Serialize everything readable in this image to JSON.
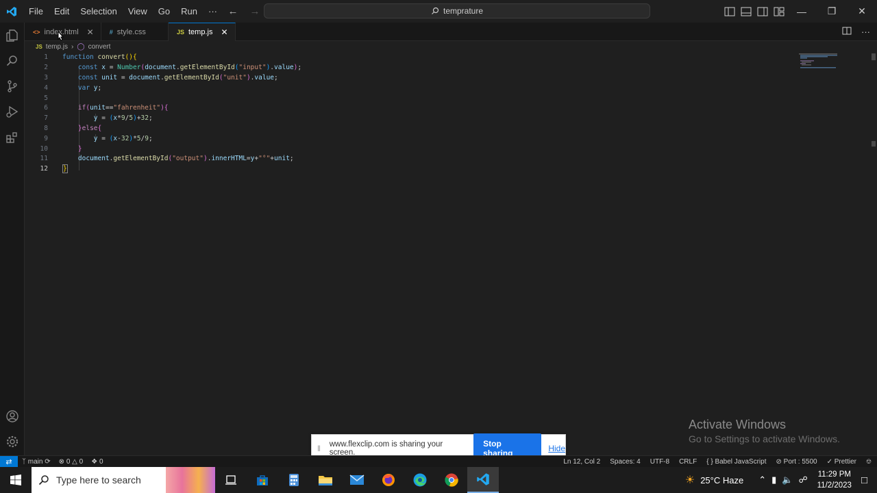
{
  "titlebar": {
    "menu": [
      "File",
      "Edit",
      "Selection",
      "View",
      "Go",
      "Run",
      "···"
    ],
    "search_text": "temprature"
  },
  "tabs": [
    {
      "icon": "<>",
      "label": "index.html",
      "icon_color": "#e37933",
      "active": false
    },
    {
      "icon": "#",
      "label": "style.css",
      "icon_color": "#519aba",
      "active": false
    },
    {
      "icon": "JS",
      "label": "temp.js",
      "icon_color": "#cbcb41",
      "active": true
    }
  ],
  "breadcrumb": {
    "file_icon": "JS",
    "file": "temp.js",
    "symbol": "convert"
  },
  "editor": {
    "line_numbers": [
      "1",
      "2",
      "3",
      "4",
      "5",
      "6",
      "7",
      "8",
      "9",
      "10",
      "11",
      "12"
    ],
    "current_line": "12"
  },
  "notification": {
    "message": "www.flexclip.com is sharing your screen.",
    "stop_label": "Stop sharing",
    "hide_label": "Hide"
  },
  "watermark": {
    "line1": "Activate Windows",
    "line2": "Go to Settings to activate Windows."
  },
  "statusbar": {
    "branch": "main",
    "errors": "0",
    "warnings": "0",
    "ports": "0",
    "position": "Ln 12, Col 2",
    "spaces": "Spaces: 4",
    "encoding": "UTF-8",
    "eol": "CRLF",
    "language": "Babel JavaScript",
    "port": "Port : 5500",
    "formatter": "Prettier"
  },
  "taskbar": {
    "search_placeholder": "Type here to search",
    "weather": "25°C  Haze",
    "time": "11:29 PM",
    "date": "11/2/2023"
  },
  "colors": {
    "accent": "#0078d4",
    "share_button": "#1a73e8",
    "editor_bg": "#1f1f1f"
  }
}
